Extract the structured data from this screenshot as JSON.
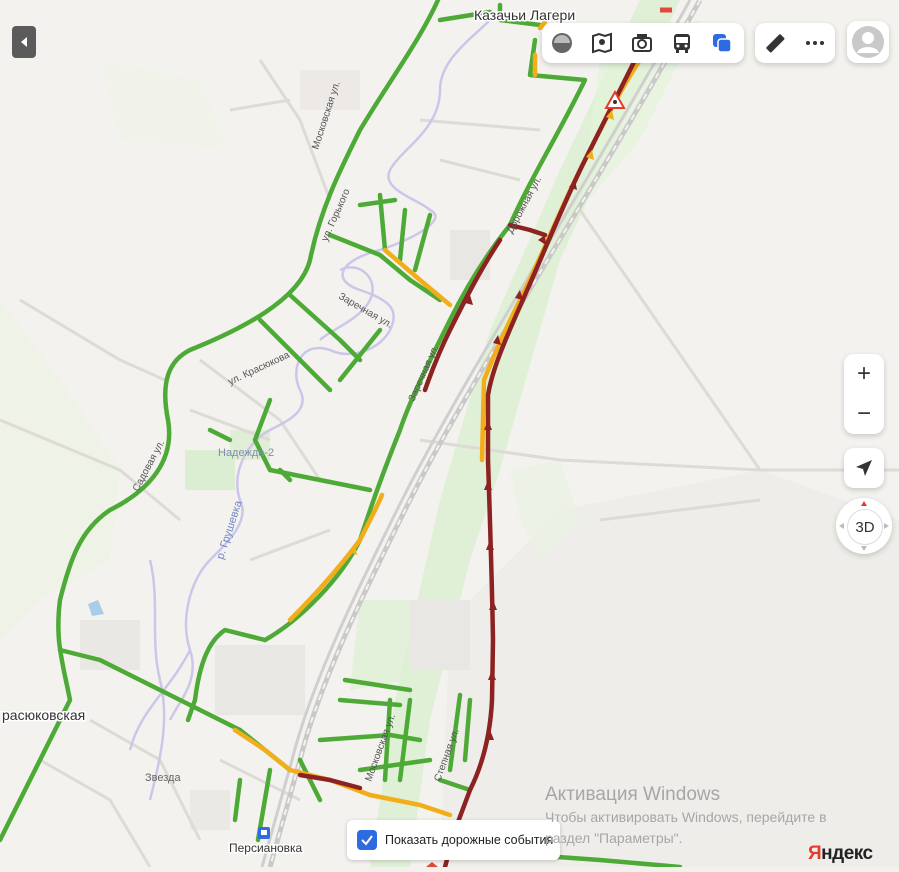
{
  "map": {
    "places": [
      {
        "id": "kazachi",
        "text": "Казачьи Лагери"
      },
      {
        "id": "krasyukovskaya",
        "text": "расюковская"
      },
      {
        "id": "nadezhda",
        "text": "Надежда-2"
      },
      {
        "id": "zvezda",
        "text": "Звезда"
      }
    ],
    "streets": [
      {
        "id": "moskovskaya_top",
        "text": "Московская ул."
      },
      {
        "id": "gorkogo",
        "text": "ул. Горького"
      },
      {
        "id": "zarechnaya",
        "text": "Заречная ул."
      },
      {
        "id": "krasyukova",
        "text": "ул. Красюкова"
      },
      {
        "id": "sadovaya",
        "text": "Садовая ул."
      },
      {
        "id": "dorozhnaya",
        "text": "Дорожная ул."
      },
      {
        "id": "zarechnaya2",
        "text": "Заречная ул."
      },
      {
        "id": "moskovskaya_bot",
        "text": "Московская ул."
      },
      {
        "id": "stepnaya",
        "text": "Степная ул."
      }
    ],
    "river": "р. Грушевка",
    "station": "Персиановка"
  },
  "toolbar": {
    "items": [
      {
        "name": "layers-icon"
      },
      {
        "name": "map-book-icon"
      },
      {
        "name": "camera-icon"
      },
      {
        "name": "bus-icon"
      },
      {
        "name": "overlay-icon"
      }
    ],
    "ruler": "ruler-icon",
    "more": "more-icon"
  },
  "controls": {
    "zoom_in": "+",
    "zoom_out": "−",
    "view_3d": "3D"
  },
  "events_toggle": {
    "label": "Показать дорожные события",
    "checked": true
  },
  "watermark": {
    "title": "Активация Windows",
    "line1": "Чтобы активировать Windows, перейдите в",
    "line2": "раздел \"Параметры\"."
  },
  "logo": {
    "first": "Я",
    "rest": "ндекс"
  },
  "colors": {
    "traffic_free": "#4eaa37",
    "traffic_slow": "#f2ad1a",
    "traffic_jam": "#8c2222",
    "accent": "#2f6be0"
  }
}
